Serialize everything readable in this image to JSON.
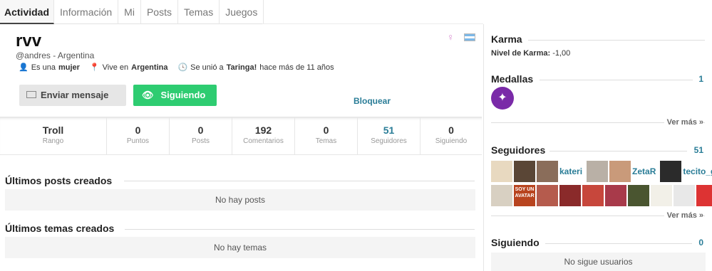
{
  "tabs": [
    {
      "label": "Actividad"
    },
    {
      "label": "Información"
    },
    {
      "label": "Mi"
    },
    {
      "label": "Posts"
    },
    {
      "label": "Temas"
    },
    {
      "label": "Juegos"
    }
  ],
  "profile": {
    "username": "rvv",
    "handle": "@andres - Argentina",
    "meta": {
      "gender_prefix": "Es una",
      "gender": "mujer",
      "lives_prefix": "Vive en",
      "country": "Argentina",
      "joined_prefix": "Se unió a",
      "site": "Taringa!",
      "joined_suffix": "hace más de 11 años"
    },
    "gender_icon": "♀",
    "flag": "argentina-flag"
  },
  "actions": {
    "message_label": "Enviar mensaje",
    "follow_label": "Siguiendo",
    "block_label": "Bloquear"
  },
  "stats": [
    {
      "value": "Troll",
      "label": "Rango"
    },
    {
      "value": "0",
      "label": "Puntos"
    },
    {
      "value": "0",
      "label": "Posts"
    },
    {
      "value": "192",
      "label": "Comentarios"
    },
    {
      "value": "0",
      "label": "Temas"
    },
    {
      "value": "51",
      "label": "Seguidores"
    },
    {
      "value": "0",
      "label": "Siguiendo"
    }
  ],
  "sections": {
    "posts_title": "Últimos posts creados",
    "posts_empty": "No hay posts",
    "topics_title": "Últimos temas creados",
    "topics_empty": "No hay temas"
  },
  "sidebar": {
    "karma_title": "Karma",
    "karma_label": "Nivel de Karma:",
    "karma_value": "-1,00",
    "medals_title": "Medallas",
    "medals_count": "1",
    "ver_mas": "Ver más »",
    "followers_title": "Seguidores",
    "followers_count": "51",
    "follower_names": [
      "kateri",
      "ZetaR",
      "tecito_g"
    ],
    "avatar_text": "SOY UN AVATAR",
    "following_title": "Siguiendo",
    "following_count": "0",
    "following_empty": "No sigue usuarios"
  },
  "colors": {
    "accent": "#2a7d97",
    "follow_button": "#2ecc71",
    "medal": "#7a2aa8"
  }
}
